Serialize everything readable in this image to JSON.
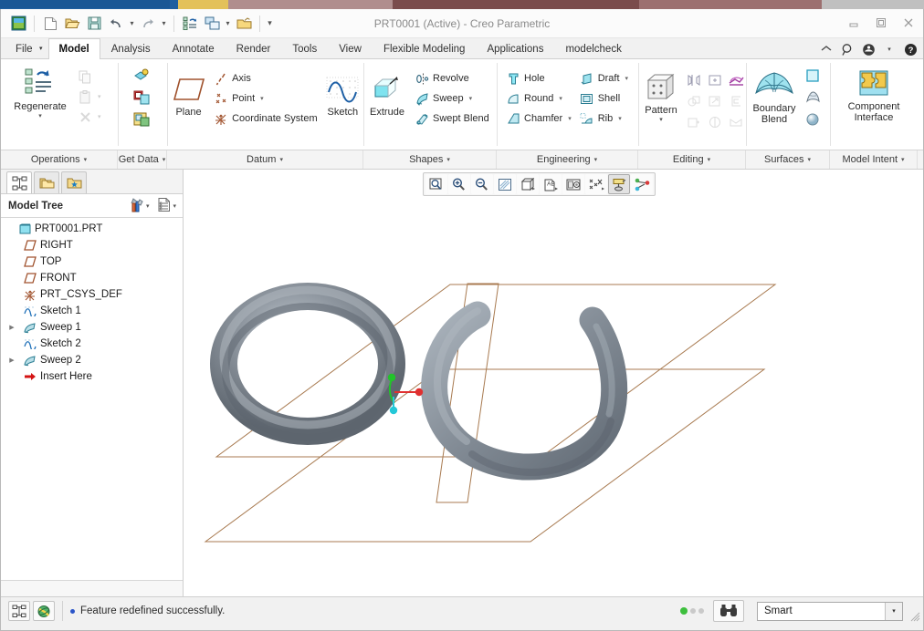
{
  "window": {
    "title": "PRT0001 (Active) - Creo Parametric",
    "minimize": "–",
    "maximize": "❐",
    "close": "✕"
  },
  "quick_access": [
    {
      "name": "creo-logo-icon",
      "label": "Creo"
    },
    {
      "name": "new-file-icon",
      "label": "New"
    },
    {
      "name": "open-file-icon",
      "label": "Open"
    },
    {
      "name": "save-icon",
      "label": "Save"
    },
    {
      "name": "undo-icon",
      "label": "Undo"
    },
    {
      "name": "undo-dropdown-caret",
      "label": "▾"
    },
    {
      "name": "redo-icon",
      "label": "Redo"
    },
    {
      "name": "redo-dropdown-caret",
      "label": "▾"
    },
    {
      "name": "regenerate-icon",
      "label": "Regenerate"
    },
    {
      "name": "window-switch-icon",
      "label": "Switch Window"
    },
    {
      "name": "window-dropdown-caret",
      "label": "▾"
    },
    {
      "name": "close-window-icon",
      "label": "Close"
    },
    {
      "name": "customize-caret",
      "label": "▾"
    }
  ],
  "help_zone": [
    {
      "name": "collapse-ribbon-icon",
      "glyph": "⌃"
    },
    {
      "name": "search-icon",
      "glyph": "search"
    },
    {
      "name": "account-icon",
      "glyph": "face"
    },
    {
      "name": "account-dropdown-caret",
      "glyph": "▾"
    },
    {
      "name": "help-icon",
      "glyph": "?"
    }
  ],
  "tabs": [
    {
      "label": "File",
      "active": false,
      "is_file": true
    },
    {
      "label": "Model",
      "active": true,
      "is_file": false
    },
    {
      "label": "Analysis",
      "active": false,
      "is_file": false
    },
    {
      "label": "Annotate",
      "active": false,
      "is_file": false
    },
    {
      "label": "Render",
      "active": false,
      "is_file": false
    },
    {
      "label": "Tools",
      "active": false,
      "is_file": false
    },
    {
      "label": "View",
      "active": false,
      "is_file": false
    },
    {
      "label": "Flexible Modeling",
      "active": false,
      "is_file": false
    },
    {
      "label": "Applications",
      "active": false,
      "is_file": false
    },
    {
      "label": "modelcheck",
      "active": false,
      "is_file": false
    }
  ],
  "ribbon": {
    "operations": {
      "group_label": "Operations",
      "regenerate_label": "Regenerate",
      "regenerate_caret": "▾",
      "copy_label": "Copy",
      "paste_label": "Paste",
      "paste_caret": "▾",
      "delete_label": "Delete",
      "delete_caret": "▾"
    },
    "get_data": {
      "group_label": "Get Data",
      "items": [
        {
          "name": "user-defined-feature-icon",
          "label": "User-Defined Feature"
        },
        {
          "name": "copy-geometry-icon",
          "label": "Copy Geometry"
        },
        {
          "name": "merge-inheritance-icon",
          "label": "Merge / Inheritance"
        }
      ]
    },
    "datum": {
      "group_label": "Datum",
      "plane_label": "Plane",
      "items": [
        {
          "name": "axis-icon",
          "label": "Axis",
          "caret": ""
        },
        {
          "name": "point-icon",
          "label": "Point",
          "caret": "▾"
        },
        {
          "name": "coordinate-system-icon",
          "label": "Coordinate System",
          "caret": ""
        }
      ],
      "sketch_label": "Sketch"
    },
    "shapes": {
      "group_label": "Shapes",
      "extrude_label": "Extrude",
      "items": [
        {
          "name": "revolve-icon",
          "label": "Revolve",
          "caret": ""
        },
        {
          "name": "sweep-icon",
          "label": "Sweep",
          "caret": "▾"
        },
        {
          "name": "swept-blend-icon",
          "label": "Swept Blend",
          "caret": ""
        }
      ]
    },
    "engineering": {
      "group_label": "Engineering",
      "col1": [
        {
          "name": "hole-icon",
          "label": "Hole",
          "caret": ""
        },
        {
          "name": "round-icon",
          "label": "Round",
          "caret": "▾"
        },
        {
          "name": "chamfer-icon",
          "label": "Chamfer",
          "caret": "▾"
        }
      ],
      "col2": [
        {
          "name": "draft-icon",
          "label": "Draft",
          "caret": "▾"
        },
        {
          "name": "shell-icon",
          "label": "Shell",
          "caret": ""
        },
        {
          "name": "rib-icon",
          "label": "Rib",
          "caret": "▾"
        }
      ]
    },
    "editing": {
      "group_label": "Editing",
      "pattern_label": "Pattern",
      "pattern_caret": "▾",
      "tools": [
        {
          "name": "mirror-icon",
          "enabled": true
        },
        {
          "name": "trim-icon",
          "enabled": true
        },
        {
          "name": "project-icon",
          "enabled": true,
          "accent": true
        },
        {
          "name": "merge-icon",
          "enabled": false
        },
        {
          "name": "extend-icon",
          "enabled": false
        },
        {
          "name": "offset-icon",
          "enabled": false
        },
        {
          "name": "thicken-icon",
          "enabled": false
        },
        {
          "name": "solidify-icon",
          "enabled": false
        },
        {
          "name": "intersect-icon",
          "enabled": false
        }
      ]
    },
    "surfaces": {
      "group_label": "Surfaces",
      "boundary_blend_label": "Boundary Blend",
      "side_tools": [
        {
          "name": "fill-surface-icon"
        },
        {
          "name": "style-surface-icon"
        },
        {
          "name": "freestyle-icon"
        }
      ]
    },
    "model_intent": {
      "group_label": "Model Intent",
      "component_interface_label": "Component Interface"
    }
  },
  "tree": {
    "tabs": [
      {
        "name": "model-tree-tab",
        "active": true
      },
      {
        "name": "folder-browser-tab",
        "active": false
      },
      {
        "name": "favorites-tab",
        "active": false
      }
    ],
    "header": {
      "title": "Model Tree",
      "settings_icon": "tools-icon",
      "settings_caret": "▾",
      "display_icon": "list-icon",
      "display_caret": "▾"
    },
    "nodes": [
      {
        "label": "PRT0001.PRT",
        "icon": "part-icon",
        "indent": 0,
        "arrow": ""
      },
      {
        "label": "RIGHT",
        "icon": "datum-plane-icon",
        "indent": 1,
        "arrow": ""
      },
      {
        "label": "TOP",
        "icon": "datum-plane-icon",
        "indent": 1,
        "arrow": ""
      },
      {
        "label": "FRONT",
        "icon": "datum-plane-icon",
        "indent": 1,
        "arrow": ""
      },
      {
        "label": "PRT_CSYS_DEF",
        "icon": "csys-icon",
        "indent": 1,
        "arrow": ""
      },
      {
        "label": "Sketch 1",
        "icon": "sketch-icon",
        "indent": 1,
        "arrow": ""
      },
      {
        "label": "Sweep 1",
        "icon": "sweep-feature-icon",
        "indent": 1,
        "arrow": "▶"
      },
      {
        "label": "Sketch 2",
        "icon": "sketch-icon",
        "indent": 1,
        "arrow": ""
      },
      {
        "label": "Sweep 2",
        "icon": "sweep-feature-icon",
        "indent": 1,
        "arrow": "▶"
      },
      {
        "label": "Insert Here",
        "icon": "insert-here-icon",
        "indent": 1,
        "arrow": ""
      }
    ]
  },
  "graphics_toolbar": [
    {
      "name": "refit-icon",
      "pressed": false
    },
    {
      "name": "zoom-in-icon",
      "pressed": false
    },
    {
      "name": "zoom-out-icon",
      "pressed": false
    },
    {
      "name": "repaint-icon",
      "pressed": false
    },
    {
      "name": "display-style-icon",
      "pressed": false
    },
    {
      "name": "saved-orientations-icon",
      "pressed": false
    },
    {
      "name": "scene-camera-icon",
      "pressed": false
    },
    {
      "name": "datum-display-filters-icon",
      "pressed": false
    },
    {
      "name": "annotation-display-icon",
      "pressed": true
    },
    {
      "name": "spin-center-icon",
      "pressed": false
    }
  ],
  "viewport": {
    "background": "#ffffff",
    "model_color": "#7b8490",
    "datum_color": "#a87a50",
    "csys_axis_colors": {
      "x": "#e03030",
      "y": "#22c32a",
      "z": "#24c8d8"
    }
  },
  "statusbar": {
    "left_buttons": [
      {
        "name": "model-tree-toggle-icon"
      },
      {
        "name": "browser-toggle-icon"
      }
    ],
    "message": "Feature redefined successfully.",
    "leds": [
      "#3dbf3d",
      "#c9c9c9",
      "#c9c9c9"
    ],
    "binoculars_button": "search-tool-icon",
    "select_mode": {
      "value": "Smart",
      "caret": "▾"
    }
  }
}
